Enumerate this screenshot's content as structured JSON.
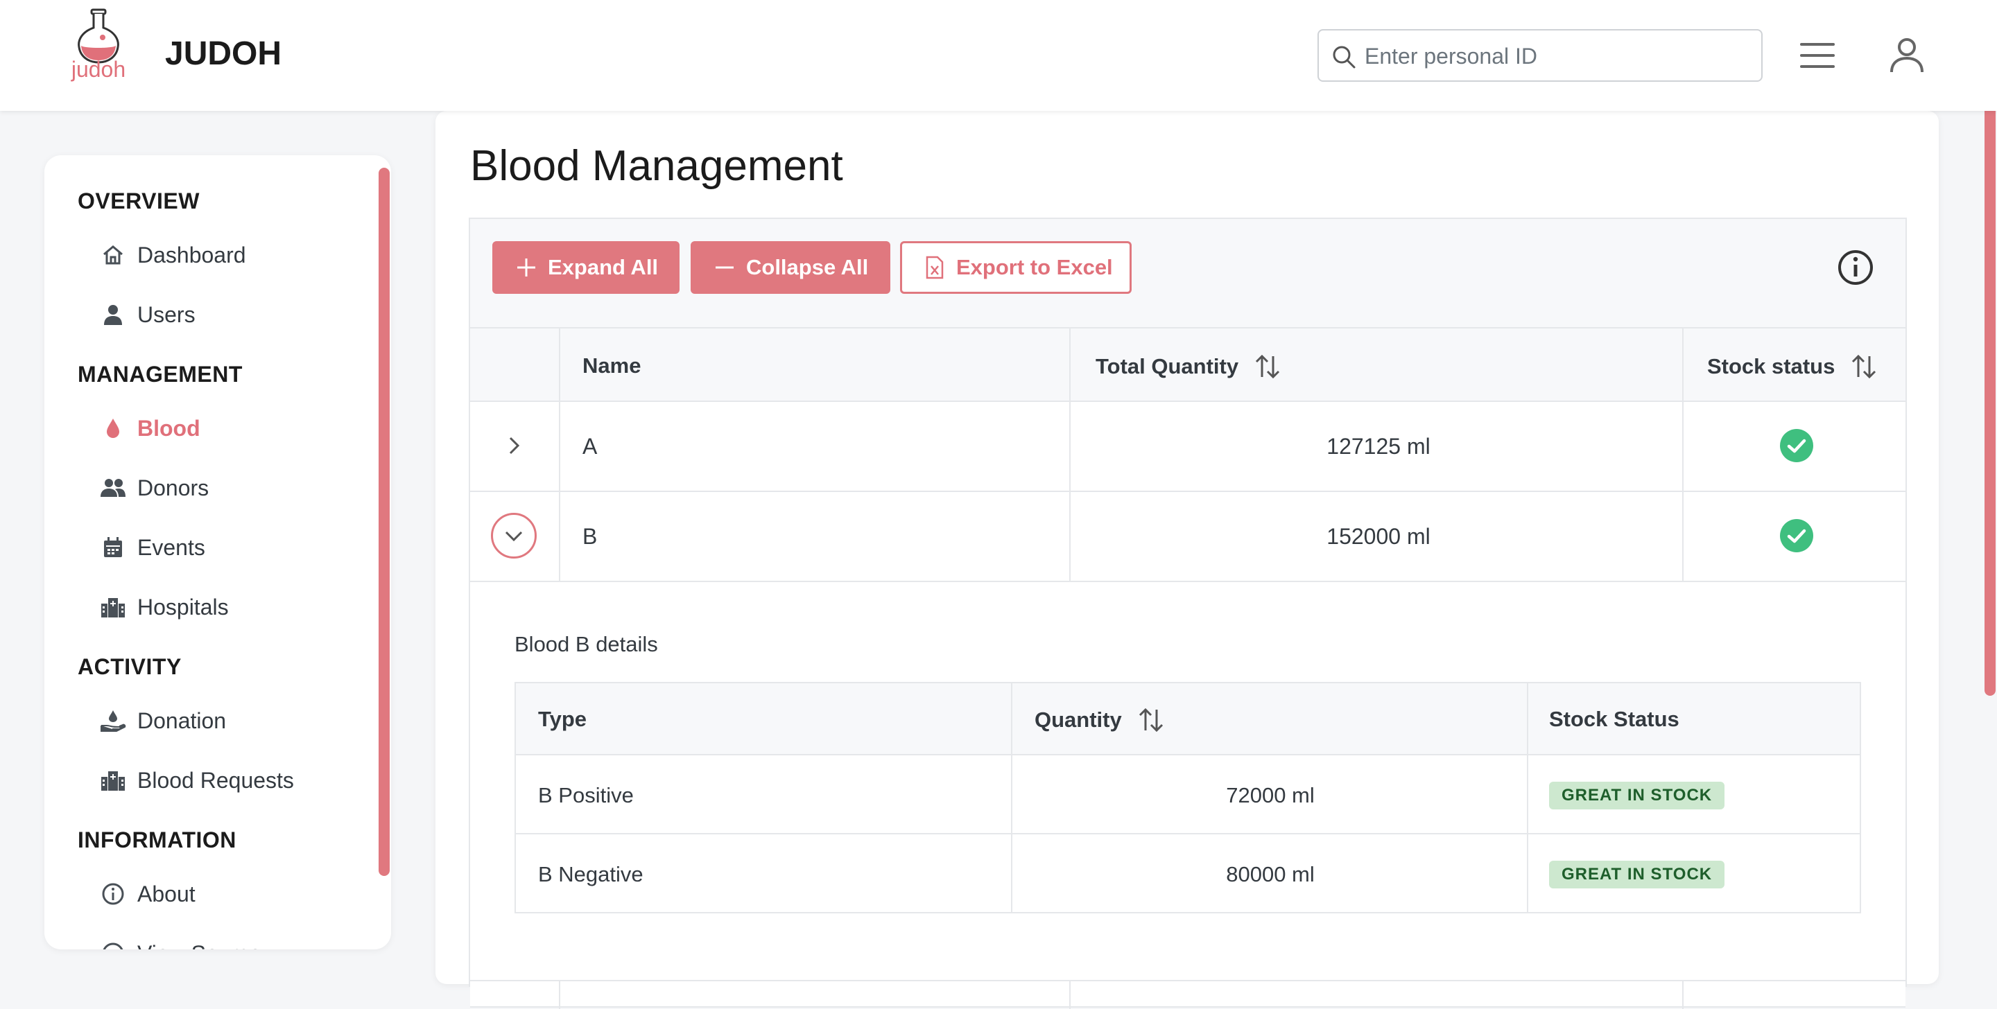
{
  "app": {
    "logo_text": "judoh",
    "title": "JUDOH"
  },
  "search": {
    "placeholder": "Enter personal ID",
    "icon": "search-icon"
  },
  "sidebar": {
    "sections": [
      {
        "title": "OVERVIEW",
        "items": [
          {
            "label": "Dashboard",
            "icon": "home-icon"
          },
          {
            "label": "Users",
            "icon": "user-icon"
          }
        ]
      },
      {
        "title": "MANAGEMENT",
        "items": [
          {
            "label": "Blood",
            "icon": "blood-drop-icon",
            "active": true
          },
          {
            "label": "Donors",
            "icon": "people-icon"
          },
          {
            "label": "Events",
            "icon": "calendar-icon"
          },
          {
            "label": "Hospitals",
            "icon": "hospital-icon"
          }
        ]
      },
      {
        "title": "ACTIVITY",
        "items": [
          {
            "label": "Donation",
            "icon": "hand-drop-icon"
          },
          {
            "label": "Blood Requests",
            "icon": "hospital-icon"
          }
        ]
      },
      {
        "title": "INFORMATION",
        "items": [
          {
            "label": "About",
            "icon": "info-icon"
          },
          {
            "label": "View Source",
            "icon": "github-icon"
          }
        ]
      }
    ]
  },
  "main": {
    "title": "Blood Management",
    "toolbar": {
      "expand_label": "Expand All",
      "collapse_label": "Collapse All",
      "export_label": "Export to Excel"
    },
    "columns": [
      "Name",
      "Total Quantity",
      "Stock status"
    ],
    "rows": [
      {
        "name": "A",
        "quantity": "127125 ml",
        "status": "check-circle-icon",
        "expanded": false
      },
      {
        "name": "B",
        "quantity": "152000 ml",
        "status": "check-circle-icon",
        "expanded": true
      }
    ],
    "detail": {
      "title": "Blood B details",
      "columns": [
        "Type",
        "Quantity",
        "Stock Status"
      ],
      "rows": [
        {
          "type": "B Positive",
          "quantity": "72000 ml",
          "status": "GREAT IN STOCK"
        },
        {
          "type": "B Negative",
          "quantity": "80000 ml",
          "status": "GREAT IN STOCK"
        }
      ]
    }
  },
  "colors": {
    "accent": "#e0787f",
    "success": "#3fbf7f",
    "badge_bg": "#cde8cf",
    "badge_text": "#1e5e2b"
  }
}
